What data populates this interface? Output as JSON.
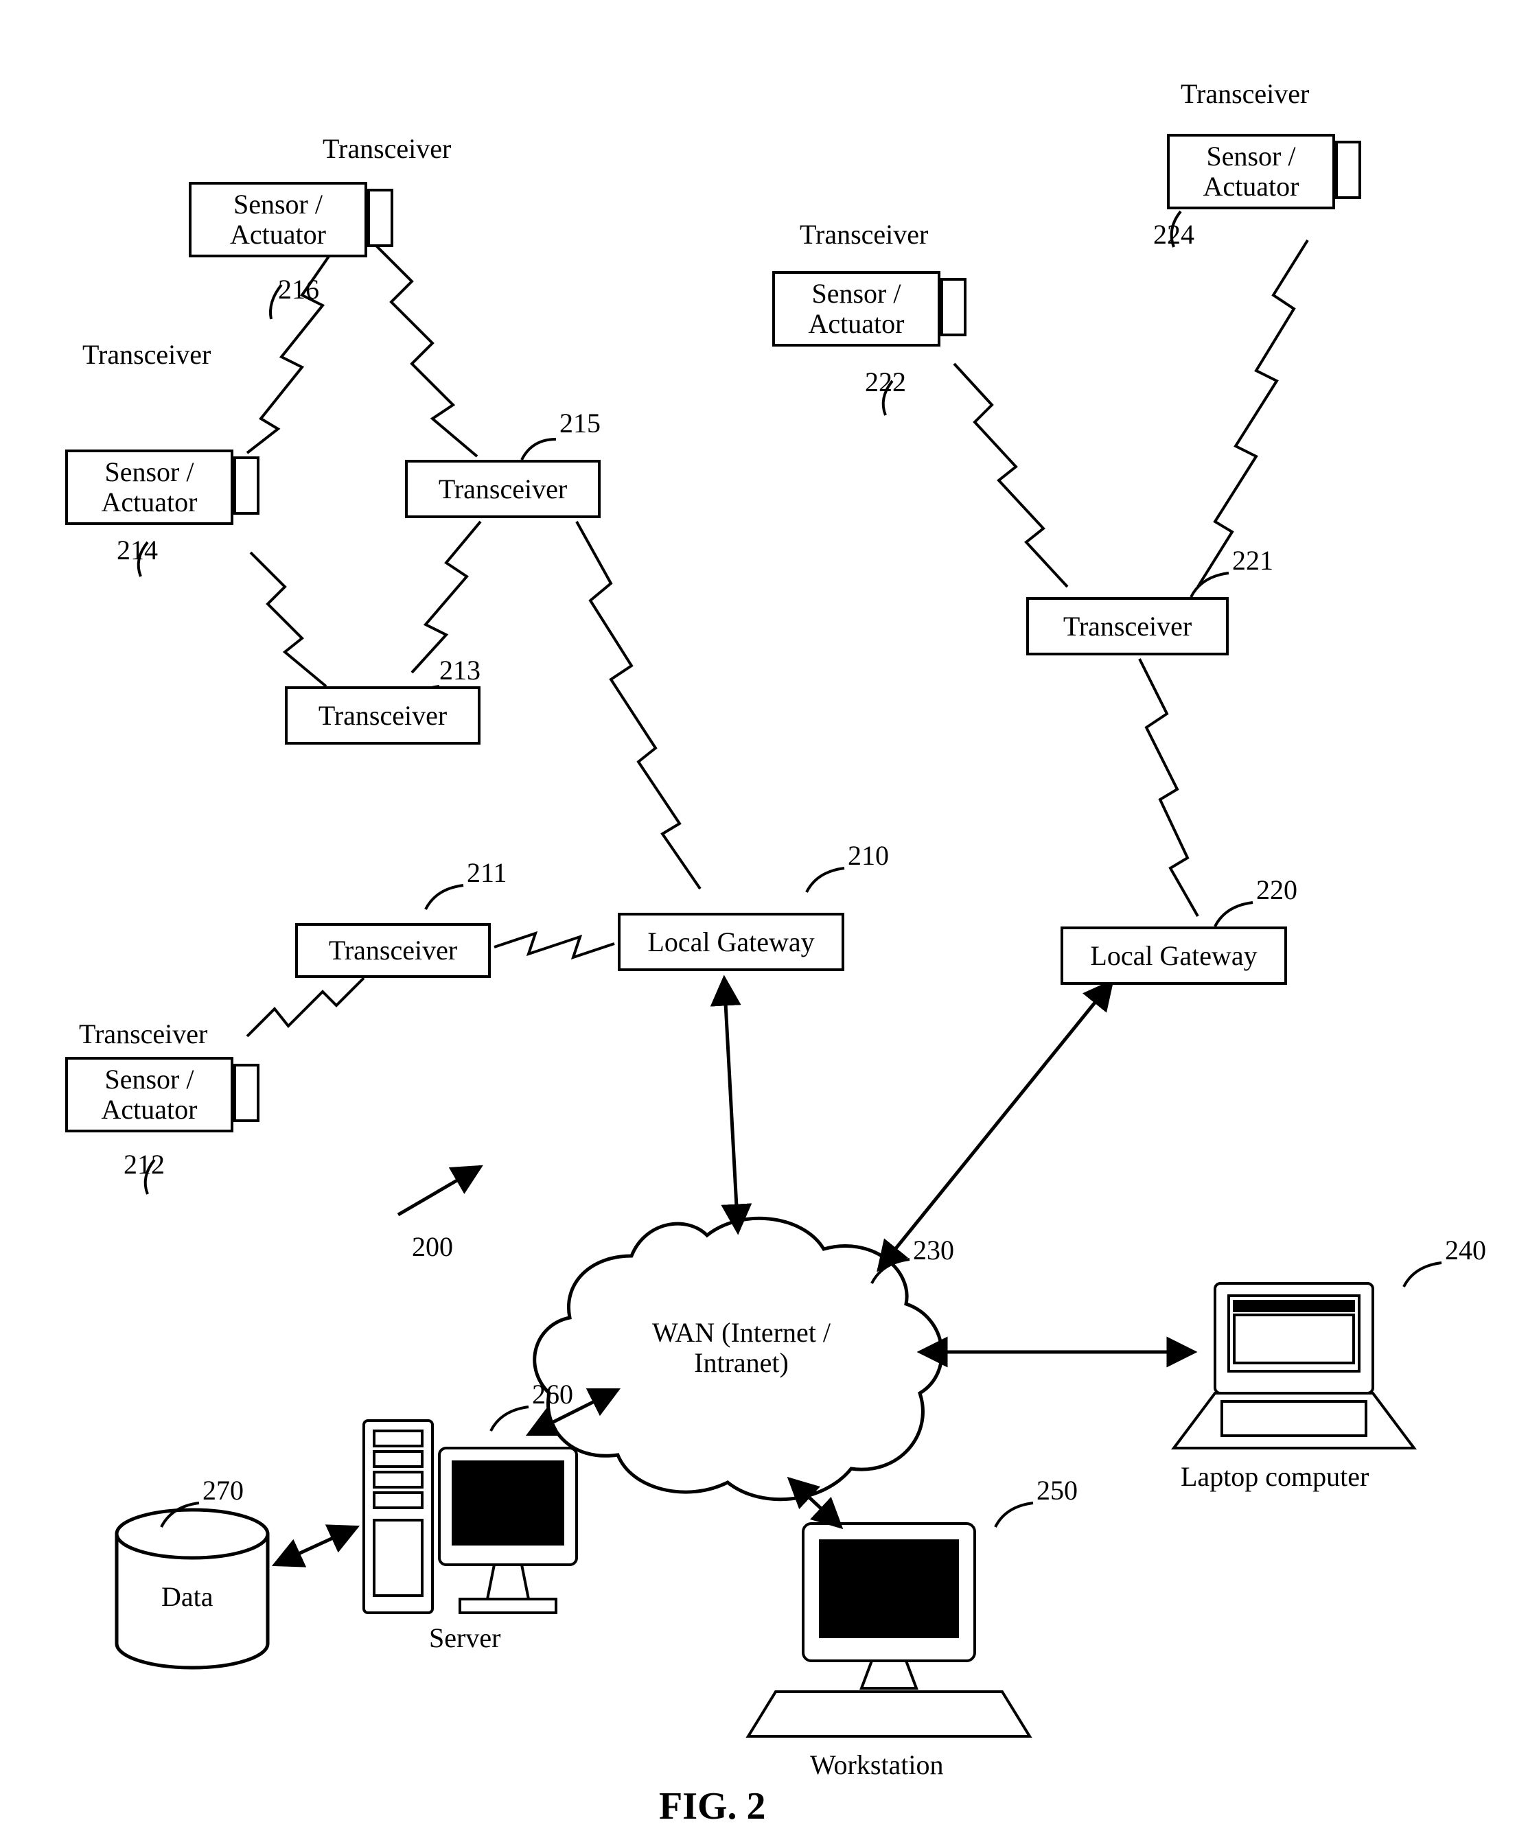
{
  "figure_label": "FIG. 2",
  "system_ref": "200",
  "nodes": {
    "sa216": {
      "text": "Sensor /\nActuator",
      "ref": "216",
      "label": "Transceiver"
    },
    "sa214": {
      "text": "Sensor /\nActuator",
      "ref": "214",
      "label": "Transceiver"
    },
    "sa212": {
      "text": "Sensor /\nActuator",
      "ref": "212",
      "label": "Transceiver"
    },
    "sa222": {
      "text": "Sensor /\nActuator",
      "ref": "222",
      "label": "Transceiver"
    },
    "sa224": {
      "text": "Sensor /\nActuator",
      "ref": "224",
      "label": "Transceiver"
    },
    "tx215": {
      "text": "Transceiver",
      "ref": "215"
    },
    "tx213": {
      "text": "Transceiver",
      "ref": "213"
    },
    "tx211": {
      "text": "Transceiver",
      "ref": "211"
    },
    "tx221": {
      "text": "Transceiver",
      "ref": "221"
    },
    "lg210": {
      "text": "Local Gateway",
      "ref": "210"
    },
    "lg220": {
      "text": "Local Gateway",
      "ref": "220"
    },
    "cloud230": {
      "text": "WAN (Internet /\nIntranet)",
      "ref": "230"
    },
    "server260": {
      "text": "Server",
      "ref": "260"
    },
    "data270": {
      "text": "Data",
      "ref": "270"
    },
    "laptop240": {
      "text": "Laptop computer",
      "ref": "240"
    },
    "ws250": {
      "text": "Workstation",
      "ref": "250"
    }
  }
}
